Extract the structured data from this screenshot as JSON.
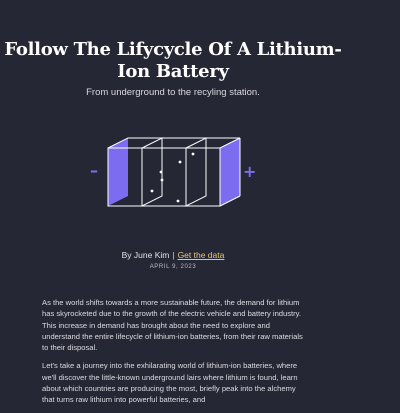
{
  "header": {
    "title": "Follow The Lifycycle Of A Lithium-Ion Battery",
    "subtitle": "From underground to the recyling station."
  },
  "illustration": {
    "minus_symbol": "–",
    "plus_symbol": "+",
    "accent_color": "#7b6cf0",
    "line_color": "#ffffff"
  },
  "byline": {
    "author": "By June Kim",
    "separator": "|",
    "data_link": "Get the data",
    "date": "APRIL 9, 2023",
    "link_color": "#e8c77a"
  },
  "article": {
    "paragraphs": [
      "As the world shifts towards a more sustainable future, the demand for lithium has skyrocketed due to the growth of the electric vehicle and battery industry. This increase in demand has brought about the need to explore and understand the entire lifecycle of lithium-ion batteries, from their raw materials to their disposal.",
      "Let's take a journey into the exhilarating world of lithium-ion batteries, where we'll discover the little-known underground lairs where lithium is found, learn about which countries are producing the most, briefly peak into the alchemy that turns raw lithium into powerful batteries, and"
    ]
  }
}
